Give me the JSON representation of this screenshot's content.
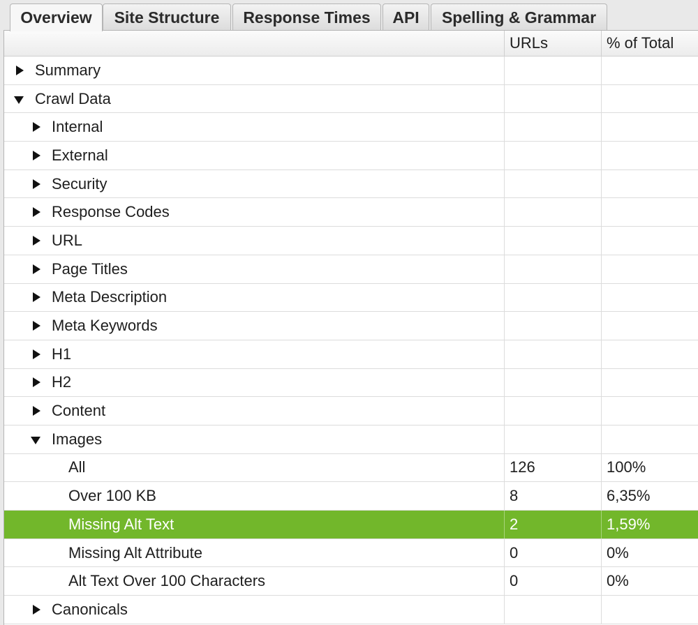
{
  "tabs": [
    {
      "label": "Overview",
      "active": true
    },
    {
      "label": "Site Structure",
      "active": false
    },
    {
      "label": "Response Times",
      "active": false
    },
    {
      "label": "API",
      "active": false
    },
    {
      "label": "Spelling & Grammar",
      "active": false
    }
  ],
  "columns": {
    "name": "",
    "urls": "URLs",
    "pct": "% of Total"
  },
  "colors": {
    "selected_row": "#72b72b"
  },
  "rows": [
    {
      "label": "Summary",
      "level": 0,
      "state": "collapsed",
      "urls": "",
      "pct": "",
      "selected": false
    },
    {
      "label": "Crawl Data",
      "level": 0,
      "state": "expanded",
      "urls": "",
      "pct": "",
      "selected": false
    },
    {
      "label": "Internal",
      "level": 1,
      "state": "collapsed",
      "urls": "",
      "pct": "",
      "selected": false
    },
    {
      "label": "External",
      "level": 1,
      "state": "collapsed",
      "urls": "",
      "pct": "",
      "selected": false
    },
    {
      "label": "Security",
      "level": 1,
      "state": "collapsed",
      "urls": "",
      "pct": "",
      "selected": false
    },
    {
      "label": "Response Codes",
      "level": 1,
      "state": "collapsed",
      "urls": "",
      "pct": "",
      "selected": false
    },
    {
      "label": "URL",
      "level": 1,
      "state": "collapsed",
      "urls": "",
      "pct": "",
      "selected": false
    },
    {
      "label": "Page Titles",
      "level": 1,
      "state": "collapsed",
      "urls": "",
      "pct": "",
      "selected": false
    },
    {
      "label": "Meta Description",
      "level": 1,
      "state": "collapsed",
      "urls": "",
      "pct": "",
      "selected": false
    },
    {
      "label": "Meta Keywords",
      "level": 1,
      "state": "collapsed",
      "urls": "",
      "pct": "",
      "selected": false
    },
    {
      "label": "H1",
      "level": 1,
      "state": "collapsed",
      "urls": "",
      "pct": "",
      "selected": false
    },
    {
      "label": "H2",
      "level": 1,
      "state": "collapsed",
      "urls": "",
      "pct": "",
      "selected": false
    },
    {
      "label": "Content",
      "level": 1,
      "state": "collapsed",
      "urls": "",
      "pct": "",
      "selected": false
    },
    {
      "label": "Images",
      "level": 1,
      "state": "expanded",
      "urls": "",
      "pct": "",
      "selected": false
    },
    {
      "label": "All",
      "level": 2,
      "state": "leaf",
      "urls": "126",
      "pct": "100%",
      "selected": false
    },
    {
      "label": "Over 100 KB",
      "level": 2,
      "state": "leaf",
      "urls": "8",
      "pct": "6,35%",
      "selected": false
    },
    {
      "label": "Missing Alt Text",
      "level": 2,
      "state": "leaf",
      "urls": "2",
      "pct": "1,59%",
      "selected": true
    },
    {
      "label": "Missing Alt Attribute",
      "level": 2,
      "state": "leaf",
      "urls": "0",
      "pct": "0%",
      "selected": false
    },
    {
      "label": "Alt Text Over 100 Characters",
      "level": 2,
      "state": "leaf",
      "urls": "0",
      "pct": "0%",
      "selected": false
    },
    {
      "label": "Canonicals",
      "level": 1,
      "state": "collapsed",
      "urls": "",
      "pct": "",
      "selected": false
    }
  ]
}
